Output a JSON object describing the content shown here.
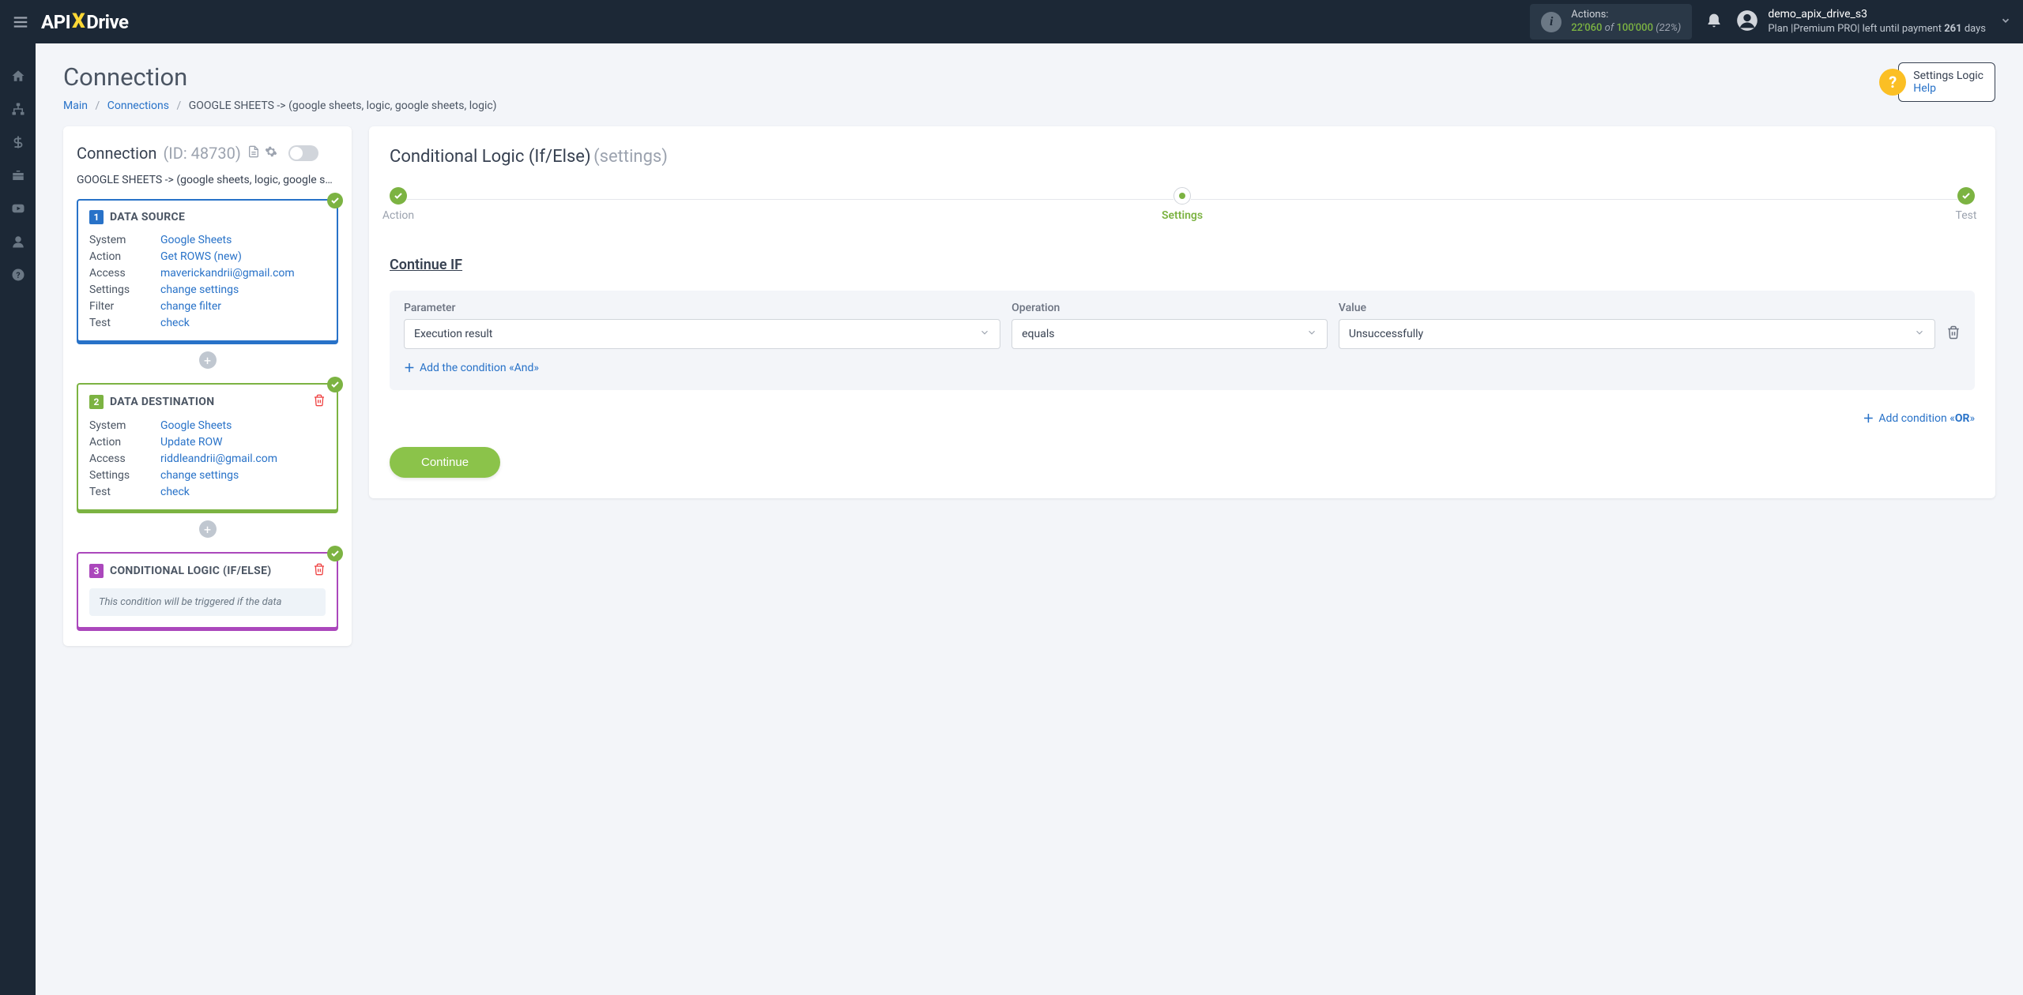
{
  "topbar": {
    "logo": {
      "prefix": "API",
      "x": "X",
      "suffix": "Drive"
    },
    "actions": {
      "label": "Actions:",
      "used": "22'060",
      "of": "of",
      "total": "100'000",
      "pct": "(22%)"
    },
    "user": {
      "name": "demo_apix_drive_s3",
      "plan_prefix": "Plan |Premium PRO| left until payment ",
      "days": "261",
      "days_suffix": " days"
    }
  },
  "page": {
    "title": "Connection",
    "breadcrumb": {
      "main": "Main",
      "connections": "Connections",
      "current": "GOOGLE SHEETS -> (google sheets, logic, google sheets, logic)"
    },
    "help": {
      "title": "Settings Logic",
      "link": "Help"
    }
  },
  "left": {
    "title": "Connection",
    "id": "(ID: 48730)",
    "subtitle": "GOOGLE SHEETS -> (google sheets, logic, google sheets, logic)",
    "blocks": [
      {
        "num": "1",
        "title": "DATA SOURCE",
        "rows": [
          {
            "label": "System",
            "value": "Google Sheets"
          },
          {
            "label": "Action",
            "value": "Get ROWS (new)"
          },
          {
            "label": "Access",
            "value": "maverickandrii@gmail.com"
          },
          {
            "label": "Settings",
            "value": "change settings"
          },
          {
            "label": "Filter",
            "value": "change filter"
          },
          {
            "label": "Test",
            "value": "check"
          }
        ]
      },
      {
        "num": "2",
        "title": "DATA DESTINATION",
        "rows": [
          {
            "label": "System",
            "value": "Google Sheets"
          },
          {
            "label": "Action",
            "value": "Update ROW"
          },
          {
            "label": "Access",
            "value": "riddleandrii@gmail.com"
          },
          {
            "label": "Settings",
            "value": "change settings"
          },
          {
            "label": "Test",
            "value": "check"
          }
        ]
      },
      {
        "num": "3",
        "title": "CONDITIONAL LOGIC (IF/ELSE)",
        "note": "This condition will be triggered if the data"
      }
    ]
  },
  "right": {
    "title": "Conditional Logic (If/Else)",
    "title_sub": "(settings)",
    "steps": {
      "action": "Action",
      "settings": "Settings",
      "test": "Test"
    },
    "heading": "Continue IF",
    "labels": {
      "parameter": "Parameter",
      "operation": "Operation",
      "value": "Value"
    },
    "condition": {
      "parameter": "Execution result",
      "operation": "equals",
      "value": "Unsuccessfully"
    },
    "add_and": "Add the condition «And»",
    "add_or_prefix": "Add condition «",
    "add_or_bold": "OR",
    "add_or_suffix": "»",
    "continue": "Continue"
  }
}
